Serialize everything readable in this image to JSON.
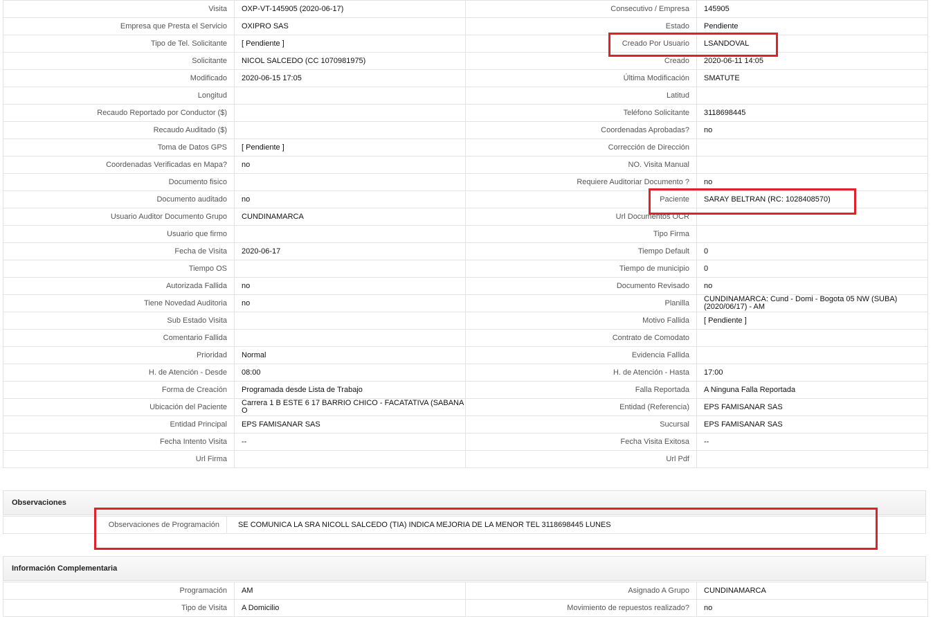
{
  "main_rows": [
    {
      "l1": "Visita",
      "v1": "OXP-VT-145905 (2020-06-17)",
      "l2": "Consecutivo / Empresa",
      "v2": "145905"
    },
    {
      "l1": "Empresa que Presta el Servicio",
      "v1": "OXIPRO SAS",
      "l2": "Estado",
      "v2": "Pendiente"
    },
    {
      "l1": "Tipo de Tel. Solicitante",
      "v1": "[ Pendiente ]",
      "l2": "Creado Por Usuario",
      "v2": "LSANDOVAL"
    },
    {
      "l1": "Solicitante",
      "v1": "NICOL SALCEDO (CC 1070981975)",
      "l2": "Creado",
      "v2": "2020-06-11 14:05"
    },
    {
      "l1": "Modificado",
      "v1": "2020-06-15 17:05",
      "l2": "Última Modificación",
      "v2": " SMATUTE"
    },
    {
      "l1": "Longitud",
      "v1": "",
      "l2": "Latitud",
      "v2": ""
    },
    {
      "l1": "Recaudo Reportado por Conductor ($)",
      "v1": "",
      "l2": "Teléfono Solicitante",
      "v2": "3118698445"
    },
    {
      "l1": "Recaudo Auditado ($)",
      "v1": "",
      "l2": "Coordenadas Aprobadas?",
      "v2": " no"
    },
    {
      "l1": "Toma de Datos GPS",
      "v1": "[ Pendiente ]",
      "l2": "Corrección de Dirección",
      "v2": ""
    },
    {
      "l1": "Coordenadas Verificadas en Mapa?",
      "v1": " no",
      "l2": "NO. Visita Manual",
      "v2": ""
    },
    {
      "l1": "Documento fisico",
      "v1": "",
      "l2": "Requiere Auditoriar Documento ?",
      "v2": " no"
    },
    {
      "l1": "Documento auditado",
      "v1": " no",
      "l2": "Paciente",
      "v2": "SARAY BELTRAN (RC: 1028408570)"
    },
    {
      "l1": "Usuario Auditor Documento Grupo",
      "v1": "CUNDINAMARCA",
      "l2": "Url Documentos OCR",
      "v2": ""
    },
    {
      "l1": "Usuario que firmo",
      "v1": "",
      "l2": "Tipo Firma",
      "v2": ""
    },
    {
      "l1": "Fecha de Visita",
      "v1": " 2020-06-17",
      "l2": "Tiempo Default",
      "v2": "0"
    },
    {
      "l1": "Tiempo OS",
      "v1": "",
      "l2": "Tiempo de municipio",
      "v2": "0"
    },
    {
      "l1": "Autorizada Fallida",
      "v1": " no",
      "l2": "Documento Revisado",
      "v2": " no"
    },
    {
      "l1": "Tiene Novedad Auditoria",
      "v1": " no",
      "l2": "Planilla",
      "v2": "CUNDINAMARCA: Cund - Domi - Bogota 05 NW (SUBA) (2020/06/17) - AM"
    },
    {
      "l1": "Sub Estado Visita",
      "v1": "",
      "l2": "Motivo Fallida",
      "v2": "[ Pendiente ]"
    },
    {
      "l1": "Comentario Fallida",
      "v1": "",
      "l2": "Contrato de Comodato",
      "v2": ""
    },
    {
      "l1": "Prioridad",
      "v1": "Normal",
      "l2": "Evidencia Fallida",
      "v2": ""
    },
    {
      "l1": "H. de Atención - Desde",
      "v1": "08:00",
      "l2": "H. de Atención - Hasta",
      "v2": "17:00"
    },
    {
      "l1": "Forma de Creación",
      "v1": "Programada desde Lista de Trabajo",
      "l2": "Falla Reportada",
      "v2": "A Ninguna Falla Reportada"
    },
    {
      "l1": "Ubicación del Paciente",
      "v1": "Carrera 1 B ESTE 6 17 BARRIO CHICO - FACATATIVA (SABANA O",
      "l2": "Entidad (Referencia)",
      "v2": "EPS FAMISANAR SAS"
    },
    {
      "l1": "Entidad Principal",
      "v1": "EPS FAMISANAR SAS",
      "l2": "Sucursal",
      "v2": "EPS FAMISANAR SAS"
    },
    {
      "l1": "Fecha Intento Visita",
      "v1": " --",
      "l2": "Fecha Visita Exitosa",
      "v2": " --"
    },
    {
      "l1": "Url Firma",
      "v1": "",
      "l2": "Url Pdf",
      "v2": ""
    }
  ],
  "observaciones": {
    "title": "Observaciones",
    "label": "Observaciones de Programación",
    "value": "SE COMUNICA LA SRA NICOLL SALCEDO (TIA) INDICA MEJORIA DE LA MENOR TEL 3118698445 LUNES"
  },
  "complementaria": {
    "title": "Información Complementaria",
    "rows": [
      {
        "l1": "Programación",
        "v1": "AM",
        "l2": "Asignado A Grupo",
        "v2": "CUNDINAMARCA"
      },
      {
        "l1": "Tipo de Visita",
        "v1": "A Domicilio",
        "l2": "Movimiento de repuestos realizado?",
        "v2": " no"
      }
    ]
  },
  "highlight_color": "#e0202a"
}
